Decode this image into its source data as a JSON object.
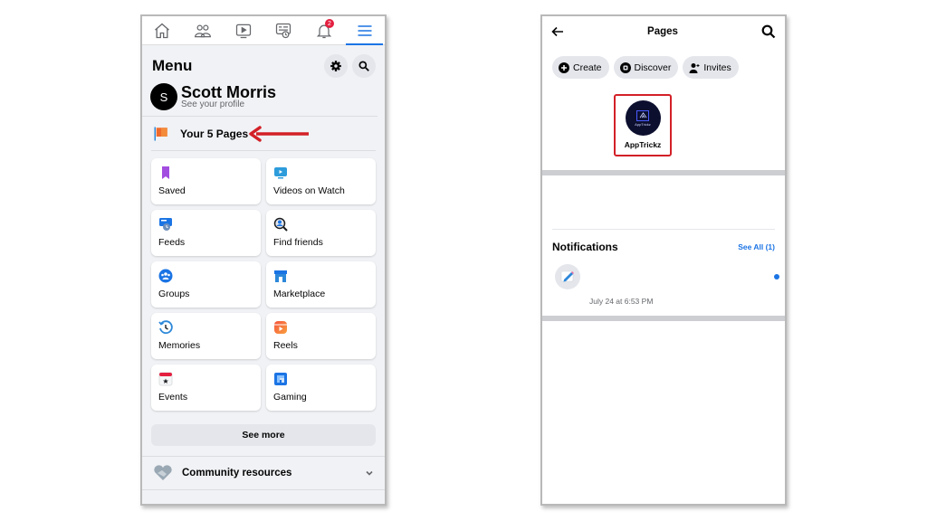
{
  "left": {
    "nav_tabs": [
      {
        "icon": "home-icon"
      },
      {
        "icon": "friends-icon"
      },
      {
        "icon": "watch-icon"
      },
      {
        "icon": "feeds-icon"
      },
      {
        "icon": "bell-icon",
        "badge": "2"
      },
      {
        "icon": "menu-icon",
        "active": true
      }
    ],
    "title": "Menu",
    "profile": {
      "initial": "S",
      "name": "Scott Morris",
      "sub": "See your profile"
    },
    "pages_label": "Your 5 Pages",
    "shortcuts": [
      {
        "label": "Saved",
        "icon": "bookmark-icon",
        "color": "#a34de0"
      },
      {
        "label": "Videos on Watch",
        "icon": "video-icon",
        "color": "#2d9cdb"
      },
      {
        "label": "Feeds",
        "icon": "feeds-icon",
        "color": "#1b74e4"
      },
      {
        "label": "Find friends",
        "icon": "find-friends-icon",
        "color": "#1b74e4"
      },
      {
        "label": "Groups",
        "icon": "groups-icon",
        "color": "#1b74e4"
      },
      {
        "label": "Marketplace",
        "icon": "marketplace-icon",
        "color": "#1b74e4"
      },
      {
        "label": "Memories",
        "icon": "memories-icon",
        "color": "#2d88d9"
      },
      {
        "label": "Reels",
        "icon": "reels-icon",
        "color": "#f05d5e"
      },
      {
        "label": "Events",
        "icon": "events-icon",
        "color": "#e41e3f"
      },
      {
        "label": "Gaming",
        "icon": "gaming-icon",
        "color": "#1b74e4"
      }
    ],
    "see_more": "See more",
    "community": "Community resources"
  },
  "right": {
    "title": "Pages",
    "chips": [
      {
        "label": "Create",
        "icon": "plus-circle-icon"
      },
      {
        "label": "Discover",
        "icon": "discover-icon"
      },
      {
        "label": "Invites",
        "icon": "invite-person-icon"
      }
    ],
    "page": {
      "name": "AppTrickz",
      "logo_text": "AppTrickz"
    },
    "notifications": {
      "title": "Notifications",
      "see_all": "See All (1)",
      "items": [
        {
          "time": "July 24 at 6:53 PM",
          "unread": true
        }
      ]
    }
  },
  "colors": {
    "accent": "#1b74e4",
    "highlight": "#d32027",
    "badge": "#e41e3f"
  }
}
